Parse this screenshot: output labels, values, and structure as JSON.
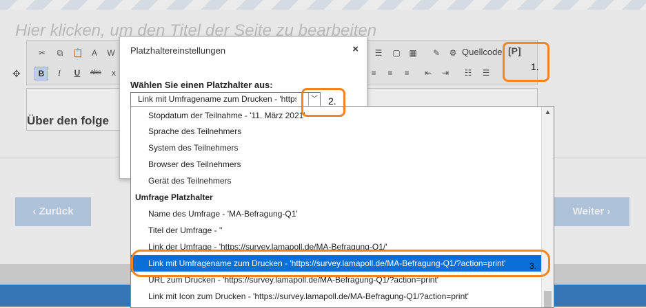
{
  "page": {
    "title_placeholder": "Hier klicken, um den Titel der Seite zu bearbeiten",
    "content_text": "Über den folge",
    "back_button": "‹ Zurück",
    "next_button": "Weiter ›"
  },
  "toolbar": {
    "source_label": "Quellcode",
    "placeholder_button": "[P]",
    "bold": "B",
    "italic": "I",
    "underline": "U",
    "strike": "abc"
  },
  "dialog": {
    "title": "Platzhaltereinstellungen",
    "close": "×",
    "label": "Wählen Sie einen Platzhalter aus:",
    "selected_value": "Link mit Umfragename zum Drucken - 'https://survey.lamapoll.de/MA-Befragung-Q1/?action=print'"
  },
  "dropdown": {
    "options": [
      {
        "label": "Stopdatum der Teilnahme - '11. März 2021'",
        "group": false,
        "selected": false
      },
      {
        "label": "Sprache des Teilnehmers",
        "group": false,
        "selected": false
      },
      {
        "label": "System des Teilnehmers",
        "group": false,
        "selected": false
      },
      {
        "label": "Browser des Teilnehmers",
        "group": false,
        "selected": false
      },
      {
        "label": "Gerät des Teilnehmers",
        "group": false,
        "selected": false
      },
      {
        "label": "Umfrage Platzhalter",
        "group": true,
        "selected": false
      },
      {
        "label": "Name des Umfrage - 'MA-Befragung-Q1'",
        "group": false,
        "selected": false
      },
      {
        "label": "Titel der Umfrage - ''",
        "group": false,
        "selected": false
      },
      {
        "label": "Link der Umfrage - 'https://survey.lamapoll.de/MA-Befragung-Q1/'",
        "group": false,
        "selected": false
      },
      {
        "label": "Link mit Umfragename zum Drucken - 'https://survey.lamapoll.de/MA-Befragung-Q1/?action=print'",
        "group": false,
        "selected": true
      },
      {
        "label": "URL zum Drucken - 'https://survey.lamapoll.de/MA-Befragung-Q1/?action=print'",
        "group": false,
        "selected": false
      },
      {
        "label": "Link mit Icon zum Drucken - 'https://survey.lamapoll.de/MA-Befragung-Q1/?action=print'",
        "group": false,
        "selected": false
      }
    ]
  },
  "annotations": {
    "one": "1.",
    "two": "2.",
    "three": "3."
  },
  "colors": {
    "accent": "#f5841f",
    "selection": "#0a6fd6"
  }
}
